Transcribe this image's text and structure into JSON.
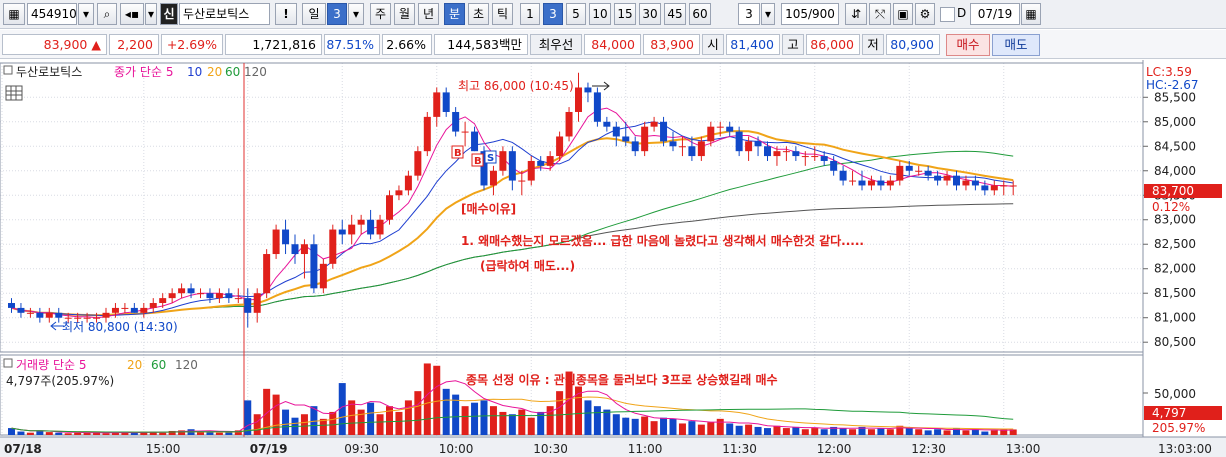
{
  "toolbar": {
    "icon_left": "grid-icon",
    "code": "454910",
    "icon_name": "shin-icon",
    "name_badge": "신",
    "stock_name": "두산로보틱스",
    "alert": "!",
    "period_day": "일",
    "period_num": "3",
    "periods": [
      "주",
      "월",
      "년",
      "분",
      "초",
      "틱"
    ],
    "minute_options": [
      "1",
      "3",
      "5",
      "10",
      "15",
      "30",
      "45",
      "60"
    ],
    "interval_value": "3",
    "count": "105/900",
    "d_label": "D",
    "date": "07/19"
  },
  "quote": {
    "price": "83,900",
    "change_arrow": "▲",
    "change": "2,200",
    "change_pct": "+2.69%",
    "volume": "1,721,816",
    "vol_ratio": "87.51%",
    "turnover": "2.66%",
    "amount": "144,583백만",
    "best_label": "최우선",
    "best_ask": "84,000",
    "best_bid": "83,900",
    "open_label": "시",
    "open": "81,400",
    "high_label": "고",
    "high": "86,000",
    "low_label": "저",
    "low": "80,900",
    "buy_button": "매수",
    "sell_button": "매도"
  },
  "price_panel": {
    "legend_name": "두산로보틱스",
    "legend_series": "종가",
    "legend_ma_type": "단순",
    "legend_periods": [
      "5",
      "10",
      "20",
      "60",
      "120"
    ],
    "lc": "LC:3.59",
    "hc": "HC:-2.67",
    "axis_ticks": [
      "85,500",
      "85,000",
      "84,500",
      "84,000",
      "83,500",
      "83,000",
      "82,500",
      "82,000",
      "81,500",
      "81,000",
      "80,500"
    ],
    "current_price": "83,700",
    "current_pct": "0.12%",
    "high_note": "최고 86,000 (10:45)",
    "low_note": "최저 80,800 (14:30)",
    "note_title": "[매수이유]",
    "note_line1": "1. 왜매수했는지 모르겠음... 급한 마음에 놀렸다고 생각해서 매수한것 같다.....",
    "note_line2": "(급락하여 매도...)",
    "buy_marker": "B",
    "sell_marker": "S"
  },
  "volume_panel": {
    "legend_name": "거래량",
    "legend_ma_type": "단순",
    "legend_periods": [
      "5",
      "20",
      "60",
      "120"
    ],
    "last_volume": "4,797주(205.97%)",
    "axis_tick": "50,000",
    "current_volume": "4,797",
    "current_pct": "205.97%",
    "note": "종목 선정 이유 : 관심종목을 둘러보다 3프로 상승했길래 매수"
  },
  "time_axis": {
    "labels": [
      "07/18",
      "15:00",
      "07/19",
      "09:30",
      "10:00",
      "10:30",
      "11:00",
      "11:30",
      "12:00",
      "12:30",
      "13:00"
    ],
    "cursor_time": "13:03:00"
  },
  "colors": {
    "up": "#e0201b",
    "down": "#1048c8",
    "ma5": "#e8149a",
    "ma10": "#1f3fd0",
    "ma20": "#f0a418",
    "ma60": "#1f9b3a",
    "ma120": "#555555"
  },
  "chart_data": {
    "type": "candlestick",
    "interval": "3-minute",
    "note": "approximate OHLC read from chart",
    "x": [
      "07/18 14:18",
      "07/18 14:21",
      "07/18 14:24",
      "07/18 14:27",
      "07/18 14:30",
      "07/18 14:33",
      "07/18 14:36",
      "07/18 14:39",
      "07/18 14:42",
      "07/18 14:45",
      "07/18 14:48",
      "07/18 14:51",
      "07/18 14:54",
      "07/18 14:57",
      "07/18 15:00",
      "07/18 15:03",
      "07/18 15:06",
      "07/18 15:09",
      "07/18 15:12",
      "07/18 15:15",
      "07/18 15:18",
      "07/18 15:21",
      "07/18 15:24",
      "07/18 15:27",
      "07/18 15:30",
      "07/19 09:00",
      "07/19 09:03",
      "07/19 09:06",
      "07/19 09:09",
      "07/19 09:12",
      "07/19 09:15",
      "07/19 09:18",
      "07/19 09:21",
      "07/19 09:24",
      "07/19 09:27",
      "07/19 09:30",
      "07/19 09:33",
      "07/19 09:36",
      "07/19 09:39",
      "07/19 09:42",
      "07/19 09:45",
      "07/19 09:48",
      "07/19 09:51",
      "07/19 09:54",
      "07/19 09:57",
      "07/19 10:00",
      "07/19 10:03",
      "07/19 10:06",
      "07/19 10:09",
      "07/19 10:12",
      "07/19 10:15",
      "07/19 10:18",
      "07/19 10:21",
      "07/19 10:24",
      "07/19 10:27",
      "07/19 10:30",
      "07/19 10:33",
      "07/19 10:36",
      "07/19 10:39",
      "07/19 10:42",
      "07/19 10:45",
      "07/19 10:48",
      "07/19 10:51",
      "07/19 10:54",
      "07/19 10:57",
      "07/19 11:00",
      "07/19 11:03",
      "07/19 11:06",
      "07/19 11:09",
      "07/19 11:12",
      "07/19 11:15",
      "07/19 11:18",
      "07/19 11:21",
      "07/19 11:24",
      "07/19 11:27",
      "07/19 11:30",
      "07/19 11:33",
      "07/19 11:36",
      "07/19 11:39",
      "07/19 11:42",
      "07/19 11:45",
      "07/19 11:48",
      "07/19 11:51",
      "07/19 11:54",
      "07/19 11:57",
      "07/19 12:00",
      "07/19 12:03",
      "07/19 12:06",
      "07/19 12:09",
      "07/19 12:12",
      "07/19 12:15",
      "07/19 12:18",
      "07/19 12:21",
      "07/19 12:24",
      "07/19 12:27",
      "07/19 12:30",
      "07/19 12:33",
      "07/19 12:36",
      "07/19 12:39",
      "07/19 12:42",
      "07/19 12:45",
      "07/19 12:48",
      "07/19 12:51",
      "07/19 12:54",
      "07/19 12:57",
      "07/19 13:00",
      "07/19 13:03"
    ],
    "open": [
      81300,
      81200,
      81100,
      81100,
      81000,
      81100,
      81000,
      81000,
      81000,
      81000,
      81000,
      81100,
      81200,
      81200,
      81100,
      81200,
      81300,
      81400,
      81500,
      81600,
      81500,
      81500,
      81400,
      81500,
      81400,
      81400,
      81100,
      81500,
      82300,
      82800,
      82500,
      82300,
      82500,
      81600,
      82100,
      82800,
      82700,
      82900,
      83000,
      82700,
      83000,
      83500,
      83600,
      83900,
      84400,
      85100,
      85600,
      85200,
      84800,
      84800,
      84400,
      83700,
      84000,
      84400,
      83800,
      83800,
      84200,
      84100,
      84300,
      84700,
      85200,
      85700,
      85600,
      85000,
      84900,
      84700,
      84600,
      84400,
      84900,
      85000,
      84600,
      84500,
      84500,
      84300,
      84600,
      84900,
      84900,
      84800,
      84400,
      84600,
      84500,
      84300,
      84400,
      84400,
      84300,
      84300,
      84300,
      84200,
      84000,
      83800,
      83800,
      83700,
      83800,
      83700,
      83800,
      84100,
      84000,
      84000,
      83900,
      83800,
      83900,
      83700,
      83800,
      83700,
      83600,
      83700,
      83700
    ],
    "high": [
      81400,
      81300,
      81200,
      81200,
      81200,
      81200,
      81100,
      81100,
      81100,
      81100,
      81200,
      81300,
      81300,
      81300,
      81300,
      81400,
      81500,
      81600,
      81700,
      81700,
      81600,
      81600,
      81600,
      81600,
      81600,
      81600,
      81600,
      82400,
      82900,
      83000,
      82700,
      82600,
      82700,
      82200,
      82900,
      83000,
      83100,
      83100,
      83200,
      83100,
      83600,
      83700,
      84000,
      84500,
      85200,
      85700,
      85700,
      85300,
      85000,
      84900,
      84500,
      84100,
      84500,
      84500,
      84000,
      84300,
      84300,
      84400,
      84800,
      85300,
      86000,
      85800,
      85700,
      85100,
      85000,
      85000,
      84700,
      85000,
      85100,
      85100,
      84800,
      84700,
      84700,
      84700,
      85000,
      85000,
      85000,
      84900,
      84700,
      84700,
      84600,
      84500,
      84500,
      84500,
      84400,
      84500,
      84400,
      84300,
      84100,
      84000,
      84000,
      83900,
      83900,
      83900,
      84200,
      84200,
      84100,
      84100,
      84000,
      84000,
      84000,
      83900,
      83900,
      83800,
      83800,
      83800,
      83800
    ],
    "low": [
      81100,
      81000,
      81000,
      80900,
      80900,
      80900,
      80900,
      80900,
      80900,
      80900,
      80900,
      81000,
      81100,
      81100,
      81000,
      81100,
      81200,
      81300,
      81400,
      81400,
      81400,
      81300,
      81300,
      81300,
      81300,
      80800,
      80900,
      81400,
      82200,
      82300,
      82100,
      81800,
      81500,
      81500,
      82000,
      82500,
      82500,
      82700,
      82600,
      82600,
      82900,
      83400,
      83500,
      83800,
      84300,
      84900,
      85100,
      84700,
      84500,
      84400,
      83600,
      83500,
      83900,
      83600,
      83500,
      83700,
      84000,
      84000,
      84200,
      84600,
      85000,
      85400,
      84900,
      84800,
      84500,
      84500,
      84300,
      84300,
      84800,
      84500,
      84400,
      84300,
      84200,
      84200,
      84500,
      84700,
      84700,
      84300,
      84200,
      84300,
      84200,
      84100,
      84200,
      84200,
      84100,
      84200,
      84100,
      83900,
      83700,
      83700,
      83600,
      83600,
      83600,
      83600,
      83700,
      83900,
      83900,
      83800,
      83700,
      83700,
      83600,
      83600,
      83600,
      83500,
      83500,
      83500,
      83500
    ],
    "close": [
      81200,
      81100,
      81100,
      81000,
      81100,
      81000,
      81000,
      81000,
      81000,
      81000,
      81100,
      81200,
      81200,
      81100,
      81200,
      81300,
      81400,
      81500,
      81600,
      81500,
      81500,
      81400,
      81500,
      81400,
      81400,
      81100,
      81500,
      82300,
      82800,
      82500,
      82300,
      82500,
      81600,
      82100,
      82800,
      82700,
      82900,
      83000,
      82700,
      83000,
      83500,
      83600,
      83900,
      84400,
      85100,
      85600,
      85200,
      84800,
      84800,
      84400,
      83700,
      84000,
      84400,
      83800,
      83800,
      84200,
      84100,
      84300,
      84700,
      85200,
      85700,
      85600,
      85000,
      84900,
      84700,
      84600,
      84400,
      84900,
      85000,
      84600,
      84500,
      84500,
      84300,
      84600,
      84900,
      84900,
      84800,
      84400,
      84600,
      84500,
      84300,
      84400,
      84400,
      84300,
      84300,
      84300,
      84200,
      84000,
      83800,
      83800,
      83700,
      83800,
      83700,
      83800,
      84100,
      84000,
      84000,
      83900,
      83800,
      83900,
      83700,
      83800,
      83700,
      83600,
      83700,
      83700,
      83700
    ],
    "volume": [
      6000,
      3000,
      2000,
      4000,
      2500,
      2000,
      1500,
      2000,
      1800,
      2500,
      1500,
      2000,
      2500,
      2000,
      3000,
      2500,
      2000,
      3500,
      4000,
      5000,
      3000,
      2500,
      2000,
      3000,
      4000,
      30000,
      18000,
      40000,
      35000,
      22000,
      15000,
      18000,
      25000,
      14000,
      20000,
      45000,
      30000,
      22000,
      28000,
      18000,
      25000,
      20000,
      30000,
      38000,
      62000,
      60000,
      40000,
      35000,
      25000,
      28000,
      30000,
      25000,
      20000,
      18000,
      22000,
      15000,
      20000,
      25000,
      38000,
      55000,
      42000,
      30000,
      25000,
      22000,
      18000,
      15000,
      14000,
      16000,
      12000,
      15000,
      14000,
      10000,
      12000,
      9000,
      11000,
      14000,
      10000,
      8000,
      9000,
      7000,
      6000,
      8000,
      6000,
      7000,
      5000,
      6000,
      5000,
      7000,
      6000,
      5000,
      7000,
      5000,
      6000,
      5000,
      8000,
      6000,
      5000,
      4000,
      5000,
      4000,
      6000,
      4000,
      5000,
      3000,
      4000,
      4797,
      4797
    ],
    "ylim": [
      80300,
      86200
    ],
    "volume_ylim": [
      0,
      65000
    ]
  }
}
